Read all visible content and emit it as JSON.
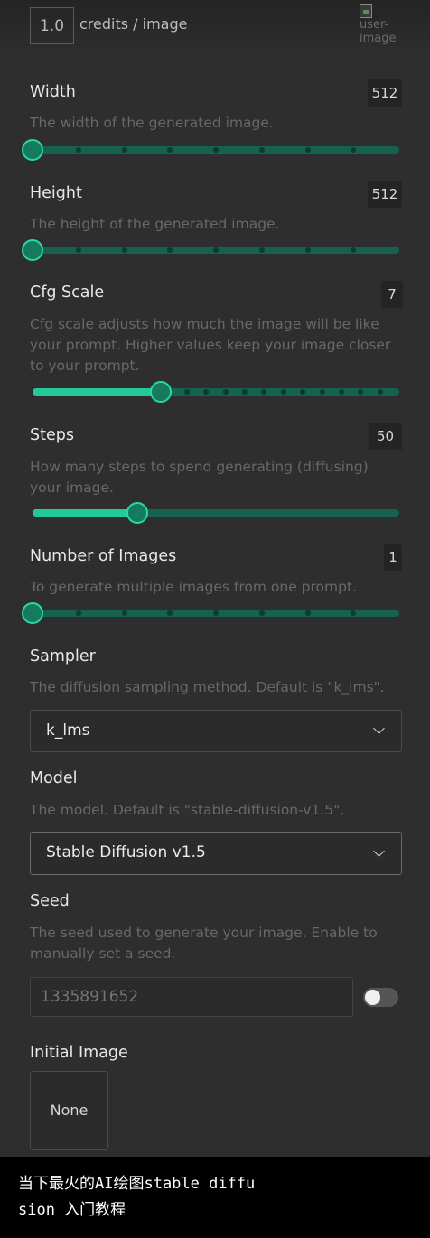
{
  "credits": {
    "value": "1.0",
    "label": "credits / image",
    "image_alt": "user-image"
  },
  "width": {
    "label": "Width",
    "value": "512",
    "description": "The width of the generated image.",
    "position": 0,
    "tick_count": 9
  },
  "height": {
    "label": "Height",
    "value": "512",
    "description": "The height of the generated image.",
    "position": 0,
    "tick_count": 9
  },
  "cfg_scale": {
    "label": "Cfg Scale",
    "value": "7",
    "description": "Cfg scale adjusts how much the image will be like your prompt. Higher values keep your image closer to your prompt.",
    "position": 0.35,
    "tick_count": 20
  },
  "steps": {
    "label": "Steps",
    "value": "50",
    "description": "How many steps to spend generating (diffusing) your image.",
    "position": 0.285,
    "tick_count": 0
  },
  "num_images": {
    "label": "Number of Images",
    "value": "1",
    "description": "To generate multiple images from one prompt.",
    "position": 0,
    "tick_count": 9
  },
  "sampler": {
    "label": "Sampler",
    "description": "The diffusion sampling method. Default is \"k_lms\".",
    "selected": "k_lms"
  },
  "model": {
    "label": "Model",
    "description": "The model. Default is \"stable-diffusion-v1.5\".",
    "selected": "Stable Diffusion v1.5"
  },
  "seed": {
    "label": "Seed",
    "description": "The seed used to generate your image. Enable to manually set a seed.",
    "placeholder": "1335891652",
    "manual_enabled": false
  },
  "initial_image": {
    "label": "Initial Image",
    "value": "None"
  },
  "caption": {
    "line1": "当下最火的AI绘图stable diffu",
    "line2": "sion 入门教程"
  },
  "colors": {
    "accent": "#23c996",
    "track": "#15624f",
    "background": "#2e2e2e"
  }
}
